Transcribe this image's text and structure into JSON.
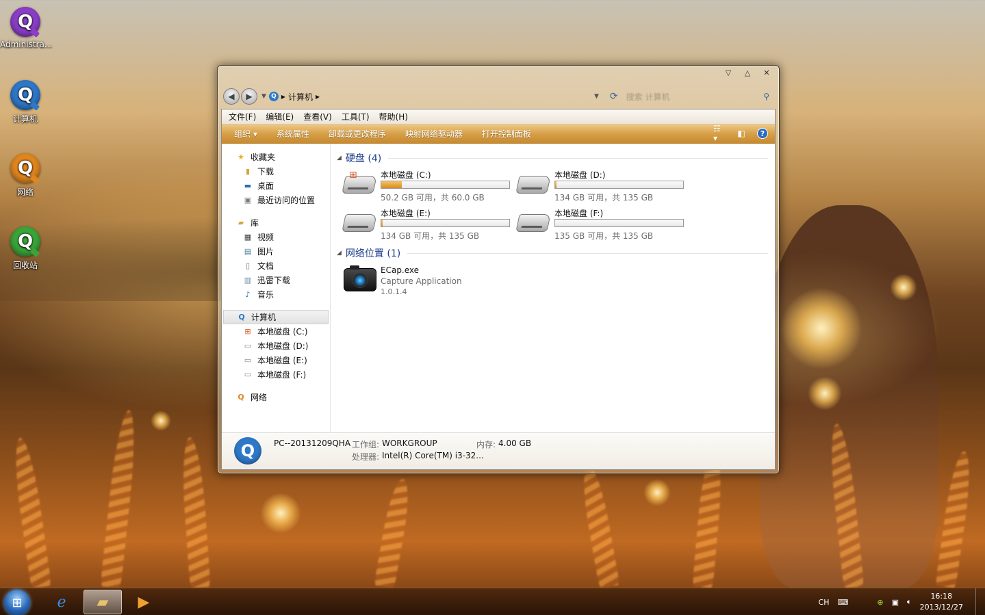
{
  "desktop": {
    "icons": [
      {
        "label": "Administra...",
        "color": "#8b3fc8"
      },
      {
        "label": "计算机",
        "color": "#2f78c8"
      },
      {
        "label": "网络",
        "color": "#e0861e"
      },
      {
        "label": "回收站",
        "color": "#3aa63a"
      }
    ]
  },
  "window": {
    "controls": {
      "minimize": "▽",
      "maximize": "△",
      "close": "✕"
    },
    "nav": {
      "back": "◀",
      "forward": "▶",
      "breadcrumb_root": "计算机",
      "search_placeholder": "搜索 计算机"
    },
    "menubar": [
      "文件(F)",
      "编辑(E)",
      "查看(V)",
      "工具(T)",
      "帮助(H)"
    ],
    "toolbar": [
      "组织 ▾",
      "系统属性",
      "卸载或更改程序",
      "映射网络驱动器",
      "打开控制面板"
    ],
    "sidebar": {
      "favorites": {
        "label": "收藏夹",
        "items": [
          "下载",
          "桌面",
          "最近访问的位置"
        ]
      },
      "libraries": {
        "label": "库",
        "items": [
          "视频",
          "图片",
          "文档",
          "迅雷下载",
          "音乐"
        ]
      },
      "computer": {
        "label": "计算机",
        "items": [
          "本地磁盘 (C:)",
          "本地磁盘 (D:)",
          "本地磁盘 (E:)",
          "本地磁盘 (F:)"
        ]
      },
      "network": {
        "label": "网络"
      }
    },
    "main": {
      "harddisk_header": "硬盘 (4)",
      "drives": [
        {
          "name": "本地磁盘 (C:)",
          "size": "50.2 GB 可用，共 60.0 GB",
          "used_fraction": 0.16
        },
        {
          "name": "本地磁盘 (D:)",
          "size": "134 GB 可用，共 135 GB",
          "used_fraction": 0.01
        },
        {
          "name": "本地磁盘 (E:)",
          "size": "134 GB 可用，共 135 GB",
          "used_fraction": 0.01
        },
        {
          "name": "本地磁盘 (F:)",
          "size": "135 GB 可用，共 135 GB",
          "used_fraction": 0.0
        }
      ],
      "network_header": "网络位置 (1)",
      "network_item": {
        "name": "ECap.exe",
        "desc": "Capture Application",
        "version": "1.0.1.4"
      }
    },
    "details": {
      "pc_name": "PC--20131209QHA",
      "workgroup_label": "工作组:",
      "workgroup": "WORKGROUP",
      "memory_label": "内存:",
      "memory": "4.00 GB",
      "cpu_label": "处理器:",
      "cpu": "Intel(R) Core(TM) i3-32..."
    }
  },
  "taskbar": {
    "lang": "CH",
    "time": "16:18",
    "date": "2013/12/27"
  }
}
